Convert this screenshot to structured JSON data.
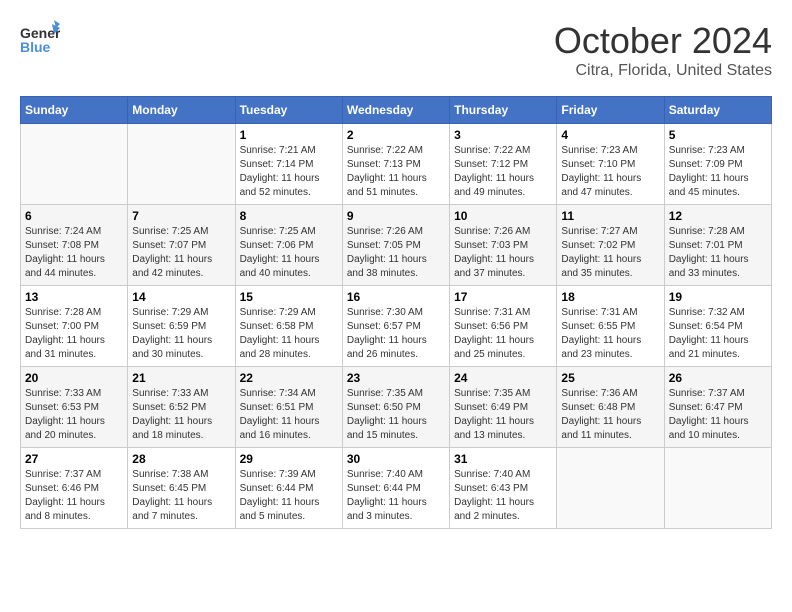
{
  "header": {
    "logo_general": "General",
    "logo_blue": "Blue",
    "month_title": "October 2024",
    "location": "Citra, Florida, United States"
  },
  "weekdays": [
    "Sunday",
    "Monday",
    "Tuesday",
    "Wednesday",
    "Thursday",
    "Friday",
    "Saturday"
  ],
  "weeks": [
    [
      {
        "day": "",
        "info": ""
      },
      {
        "day": "",
        "info": ""
      },
      {
        "day": "1",
        "info": "Sunrise: 7:21 AM\nSunset: 7:14 PM\nDaylight: 11 hours and 52 minutes."
      },
      {
        "day": "2",
        "info": "Sunrise: 7:22 AM\nSunset: 7:13 PM\nDaylight: 11 hours and 51 minutes."
      },
      {
        "day": "3",
        "info": "Sunrise: 7:22 AM\nSunset: 7:12 PM\nDaylight: 11 hours and 49 minutes."
      },
      {
        "day": "4",
        "info": "Sunrise: 7:23 AM\nSunset: 7:10 PM\nDaylight: 11 hours and 47 minutes."
      },
      {
        "day": "5",
        "info": "Sunrise: 7:23 AM\nSunset: 7:09 PM\nDaylight: 11 hours and 45 minutes."
      }
    ],
    [
      {
        "day": "6",
        "info": "Sunrise: 7:24 AM\nSunset: 7:08 PM\nDaylight: 11 hours and 44 minutes."
      },
      {
        "day": "7",
        "info": "Sunrise: 7:25 AM\nSunset: 7:07 PM\nDaylight: 11 hours and 42 minutes."
      },
      {
        "day": "8",
        "info": "Sunrise: 7:25 AM\nSunset: 7:06 PM\nDaylight: 11 hours and 40 minutes."
      },
      {
        "day": "9",
        "info": "Sunrise: 7:26 AM\nSunset: 7:05 PM\nDaylight: 11 hours and 38 minutes."
      },
      {
        "day": "10",
        "info": "Sunrise: 7:26 AM\nSunset: 7:03 PM\nDaylight: 11 hours and 37 minutes."
      },
      {
        "day": "11",
        "info": "Sunrise: 7:27 AM\nSunset: 7:02 PM\nDaylight: 11 hours and 35 minutes."
      },
      {
        "day": "12",
        "info": "Sunrise: 7:28 AM\nSunset: 7:01 PM\nDaylight: 11 hours and 33 minutes."
      }
    ],
    [
      {
        "day": "13",
        "info": "Sunrise: 7:28 AM\nSunset: 7:00 PM\nDaylight: 11 hours and 31 minutes."
      },
      {
        "day": "14",
        "info": "Sunrise: 7:29 AM\nSunset: 6:59 PM\nDaylight: 11 hours and 30 minutes."
      },
      {
        "day": "15",
        "info": "Sunrise: 7:29 AM\nSunset: 6:58 PM\nDaylight: 11 hours and 28 minutes."
      },
      {
        "day": "16",
        "info": "Sunrise: 7:30 AM\nSunset: 6:57 PM\nDaylight: 11 hours and 26 minutes."
      },
      {
        "day": "17",
        "info": "Sunrise: 7:31 AM\nSunset: 6:56 PM\nDaylight: 11 hours and 25 minutes."
      },
      {
        "day": "18",
        "info": "Sunrise: 7:31 AM\nSunset: 6:55 PM\nDaylight: 11 hours and 23 minutes."
      },
      {
        "day": "19",
        "info": "Sunrise: 7:32 AM\nSunset: 6:54 PM\nDaylight: 11 hours and 21 minutes."
      }
    ],
    [
      {
        "day": "20",
        "info": "Sunrise: 7:33 AM\nSunset: 6:53 PM\nDaylight: 11 hours and 20 minutes."
      },
      {
        "day": "21",
        "info": "Sunrise: 7:33 AM\nSunset: 6:52 PM\nDaylight: 11 hours and 18 minutes."
      },
      {
        "day": "22",
        "info": "Sunrise: 7:34 AM\nSunset: 6:51 PM\nDaylight: 11 hours and 16 minutes."
      },
      {
        "day": "23",
        "info": "Sunrise: 7:35 AM\nSunset: 6:50 PM\nDaylight: 11 hours and 15 minutes."
      },
      {
        "day": "24",
        "info": "Sunrise: 7:35 AM\nSunset: 6:49 PM\nDaylight: 11 hours and 13 minutes."
      },
      {
        "day": "25",
        "info": "Sunrise: 7:36 AM\nSunset: 6:48 PM\nDaylight: 11 hours and 11 minutes."
      },
      {
        "day": "26",
        "info": "Sunrise: 7:37 AM\nSunset: 6:47 PM\nDaylight: 11 hours and 10 minutes."
      }
    ],
    [
      {
        "day": "27",
        "info": "Sunrise: 7:37 AM\nSunset: 6:46 PM\nDaylight: 11 hours and 8 minutes."
      },
      {
        "day": "28",
        "info": "Sunrise: 7:38 AM\nSunset: 6:45 PM\nDaylight: 11 hours and 7 minutes."
      },
      {
        "day": "29",
        "info": "Sunrise: 7:39 AM\nSunset: 6:44 PM\nDaylight: 11 hours and 5 minutes."
      },
      {
        "day": "30",
        "info": "Sunrise: 7:40 AM\nSunset: 6:44 PM\nDaylight: 11 hours and 3 minutes."
      },
      {
        "day": "31",
        "info": "Sunrise: 7:40 AM\nSunset: 6:43 PM\nDaylight: 11 hours and 2 minutes."
      },
      {
        "day": "",
        "info": ""
      },
      {
        "day": "",
        "info": ""
      }
    ]
  ]
}
